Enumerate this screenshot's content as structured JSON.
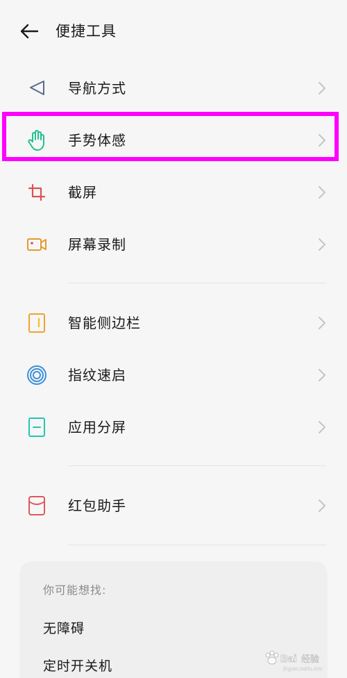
{
  "header": {
    "title": "便捷工具",
    "back_icon": "arrow-left-icon"
  },
  "section1": {
    "items": [
      {
        "label": "导航方式",
        "icon": "navigation-arrow-icon",
        "color": "#5a6b8c"
      },
      {
        "label": "手势体感",
        "icon": "hand-gesture-icon",
        "color": "#1fbf8f",
        "highlighted": true
      },
      {
        "label": "截屏",
        "icon": "crop-screenshot-icon",
        "color": "#d9534f"
      },
      {
        "label": "屏幕录制",
        "icon": "screen-record-icon",
        "color": "#e39b2d"
      }
    ]
  },
  "section2": {
    "items": [
      {
        "label": "智能侧边栏",
        "icon": "sidebar-icon",
        "color": "#f0a22e"
      },
      {
        "label": "指纹速启",
        "icon": "fingerprint-icon",
        "color": "#3b8fd9"
      },
      {
        "label": "应用分屏",
        "icon": "split-screen-icon",
        "color": "#1fc7b4"
      }
    ]
  },
  "section3": {
    "items": [
      {
        "label": "红包助手",
        "icon": "red-envelope-icon",
        "color": "#e0565c"
      }
    ]
  },
  "suggestions": {
    "title": "你可能想找:",
    "items": [
      "无障碍",
      "定时开关机"
    ]
  },
  "highlight_color": "#ff00ff",
  "watermark": {
    "text": "Baidu经验",
    "url": "jingyan.baidu.com"
  }
}
